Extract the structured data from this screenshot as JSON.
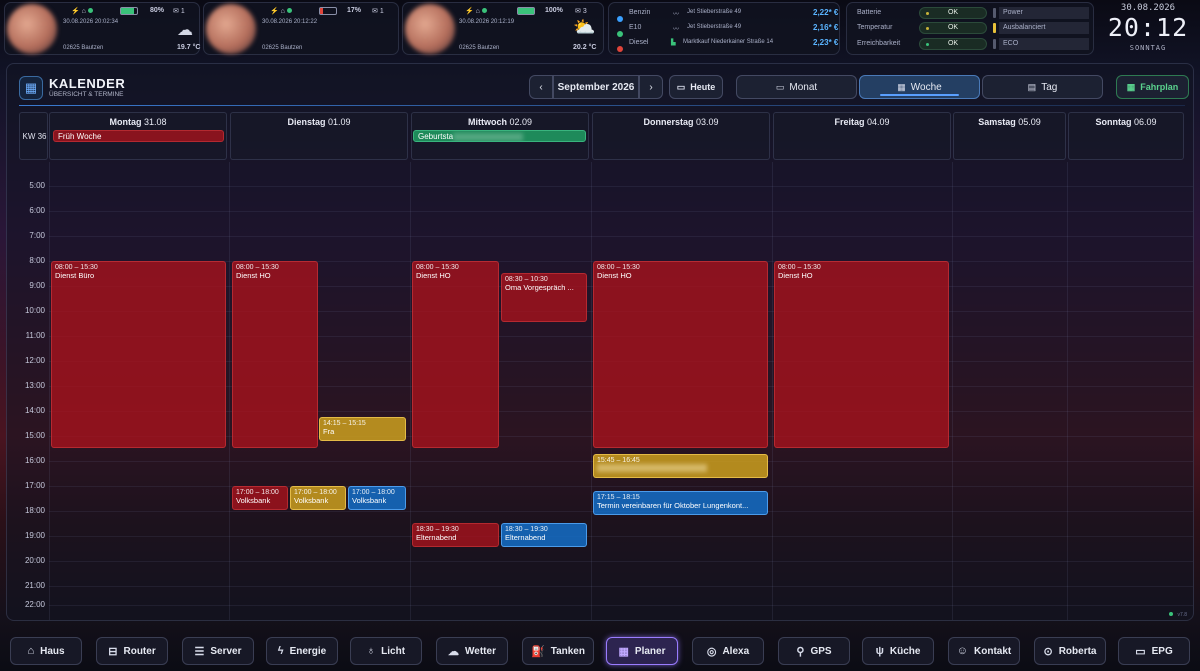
{
  "phones": [
    {
      "battery": "80%",
      "msgs": "1",
      "date": "30.08.2026 20:02:34",
      "place": "02625 Bautzen",
      "temp": "19.7 °C"
    },
    {
      "battery": "17%",
      "msgs": "1",
      "date": "30.08.2026 20:12:22",
      "place": "02625 Bautzen",
      "temp": ""
    },
    {
      "battery": "100%",
      "msgs": "3",
      "date": "30.08.2026 20:12:19",
      "place": "02625 Bautzen",
      "temp": "20.2 °C"
    }
  ],
  "fuel": [
    {
      "type": "Benzin",
      "station": "Jet Stieberstraße 49",
      "price": "2,22* €",
      "color": "#3aa0ff"
    },
    {
      "type": "E10",
      "station": "Jet Stieberstraße 49",
      "price": "2,16* €",
      "color": "#3ac27a"
    },
    {
      "type": "Diesel",
      "station": "Marktkauf Niederkainer Straße 14",
      "price": "2,23* €",
      "color": "#e0443a"
    }
  ],
  "status": [
    {
      "label": "Batterie",
      "value": "OK",
      "right": "Power",
      "rightColor": "#555a6e"
    },
    {
      "label": "Temperatur",
      "value": "OK",
      "right": "Ausbalanciert",
      "rightColor": "#e8c23a"
    },
    {
      "label": "Erreichbarkeit",
      "value": "OK",
      "right": "ECO",
      "rightColor": "#555a6e"
    }
  ],
  "clock": {
    "date": "30.08.2026",
    "time": "20:12",
    "day": "SONNTAG"
  },
  "calendar": {
    "title": "KALENDER",
    "subtitle": "ÜBERSICHT & TERMINE",
    "month": "September 2026",
    "today": "Heute",
    "views": [
      "Monat",
      "Woche",
      "Tag"
    ],
    "fahrplan": "Fahrplan",
    "week": "KW 36",
    "days": [
      {
        "name": "Montag",
        "date": "31.08"
      },
      {
        "name": "Dienstag",
        "date": "01.09"
      },
      {
        "name": "Mittwoch",
        "date": "02.09"
      },
      {
        "name": "Donnerstag",
        "date": "03.09"
      },
      {
        "name": "Freitag",
        "date": "04.09"
      },
      {
        "name": "Samstag",
        "date": "05.09"
      },
      {
        "name": "Sonntag",
        "date": "06.09"
      }
    ],
    "hours": [
      "5:00",
      "6:00",
      "7:00",
      "8:00",
      "9:00",
      "10:00",
      "11:00",
      "12:00",
      "13:00",
      "14:00",
      "15:00",
      "16:00",
      "17:00",
      "18:00",
      "19:00",
      "20:00",
      "21:00",
      "22:00"
    ],
    "allday": [
      {
        "title": "Früh Woche"
      },
      {
        "title": "Geburtsta"
      }
    ],
    "events": [
      {
        "time": "08:00 – 15:30",
        "title": "Dienst Büro"
      },
      {
        "time": "08:00 – 15:30",
        "title": "Dienst HO"
      },
      {
        "time": "14:15 – 15:15",
        "title": "Fra"
      },
      {
        "time": "17:00 – 18:00",
        "title": "Volksbank"
      },
      {
        "time": "17:00 – 18:00",
        "title": "Volksbank"
      },
      {
        "time": "17:00 – 18:00",
        "title": "Volksbank"
      },
      {
        "time": "08:00 – 15:30",
        "title": "Dienst HO"
      },
      {
        "time": "08:30 – 10:30",
        "title": "Oma Vorgespräch ..."
      },
      {
        "time": "18:30 – 19:30",
        "title": "Elternabend"
      },
      {
        "time": "18:30 – 19:30",
        "title": "Elternabend"
      },
      {
        "time": "08:00 – 15:30",
        "title": "Dienst HO"
      },
      {
        "time": "15:45 – 16:45",
        "title": ""
      },
      {
        "time": "17:15 – 18:15",
        "title": "Termin vereinbaren für Oktober Lungenkont..."
      },
      {
        "time": "08:00 – 15:30",
        "title": "Dienst HO"
      }
    ],
    "version": "v7.8"
  },
  "nav": [
    "Haus",
    "Router",
    "Server",
    "Energie",
    "Licht",
    "Wetter",
    "Tanken",
    "Planer",
    "Alexa",
    "GPS",
    "Küche",
    "Kontakt",
    "Roberta",
    "EPG"
  ]
}
